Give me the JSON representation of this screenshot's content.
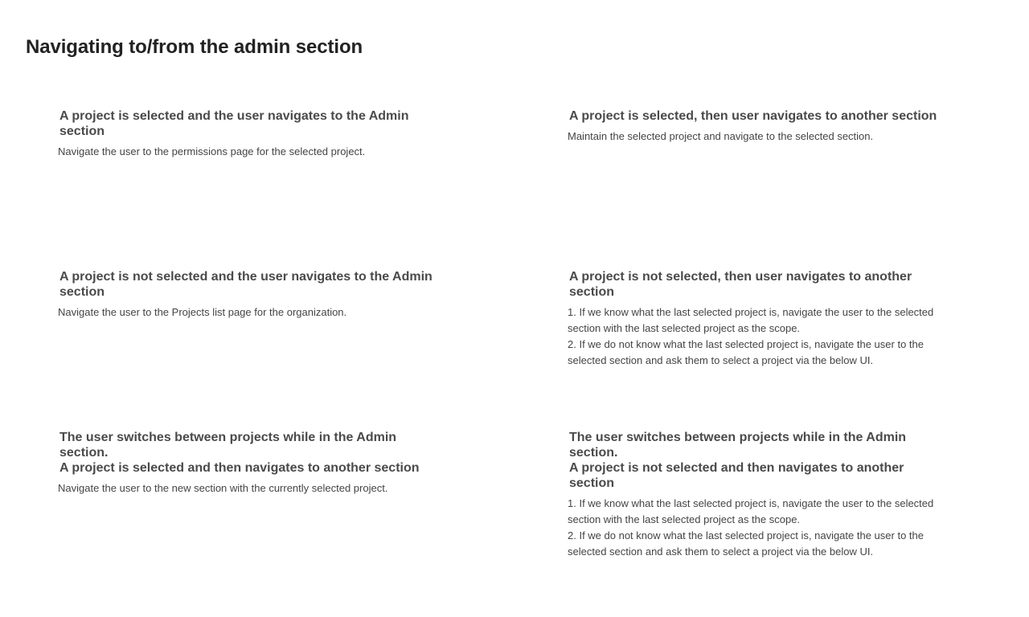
{
  "page": {
    "title": "Navigating to/from the admin section"
  },
  "cards": [
    {
      "title_lines": [
        "A project is selected and the user navigates to the Admin section"
      ],
      "body_lines": [
        "Navigate the user to the permissions page for the selected project."
      ]
    },
    {
      "title_lines": [
        "A project is selected, then user navigates to another section"
      ],
      "body_lines": [
        "Maintain the selected project and navigate to the selected section."
      ]
    },
    {
      "title_lines": [
        "A project is not selected and the user navigates to the Admin section"
      ],
      "body_lines": [
        "Navigate the user to the Projects list page for the organization."
      ]
    },
    {
      "title_lines": [
        "A project is not selected, then user navigates to another section"
      ],
      "body_lines": [
        "1. If we know what the last selected project is, navigate the user to the selected section with the last selected project as the scope.",
        "2. If we do not know what the last selected project is, navigate the user to the selected section and ask them to select a project via the below UI."
      ]
    },
    {
      "title_lines": [
        "The user switches between projects while in the Admin section.",
        "A project is selected and then navigates to another section"
      ],
      "body_lines": [
        "Navigate the user to the new section with the currently selected project."
      ]
    },
    {
      "title_lines": [
        "The user switches between projects while in the Admin section.",
        "A project is not selected and then navigates to another section"
      ],
      "body_lines": [
        "1. If we know what the last selected project is, navigate the user to the selected section with the last selected project as the scope.",
        "2. If we do not know what the last selected project is, navigate the user to the selected section and ask them to select a project via the below UI."
      ]
    }
  ]
}
